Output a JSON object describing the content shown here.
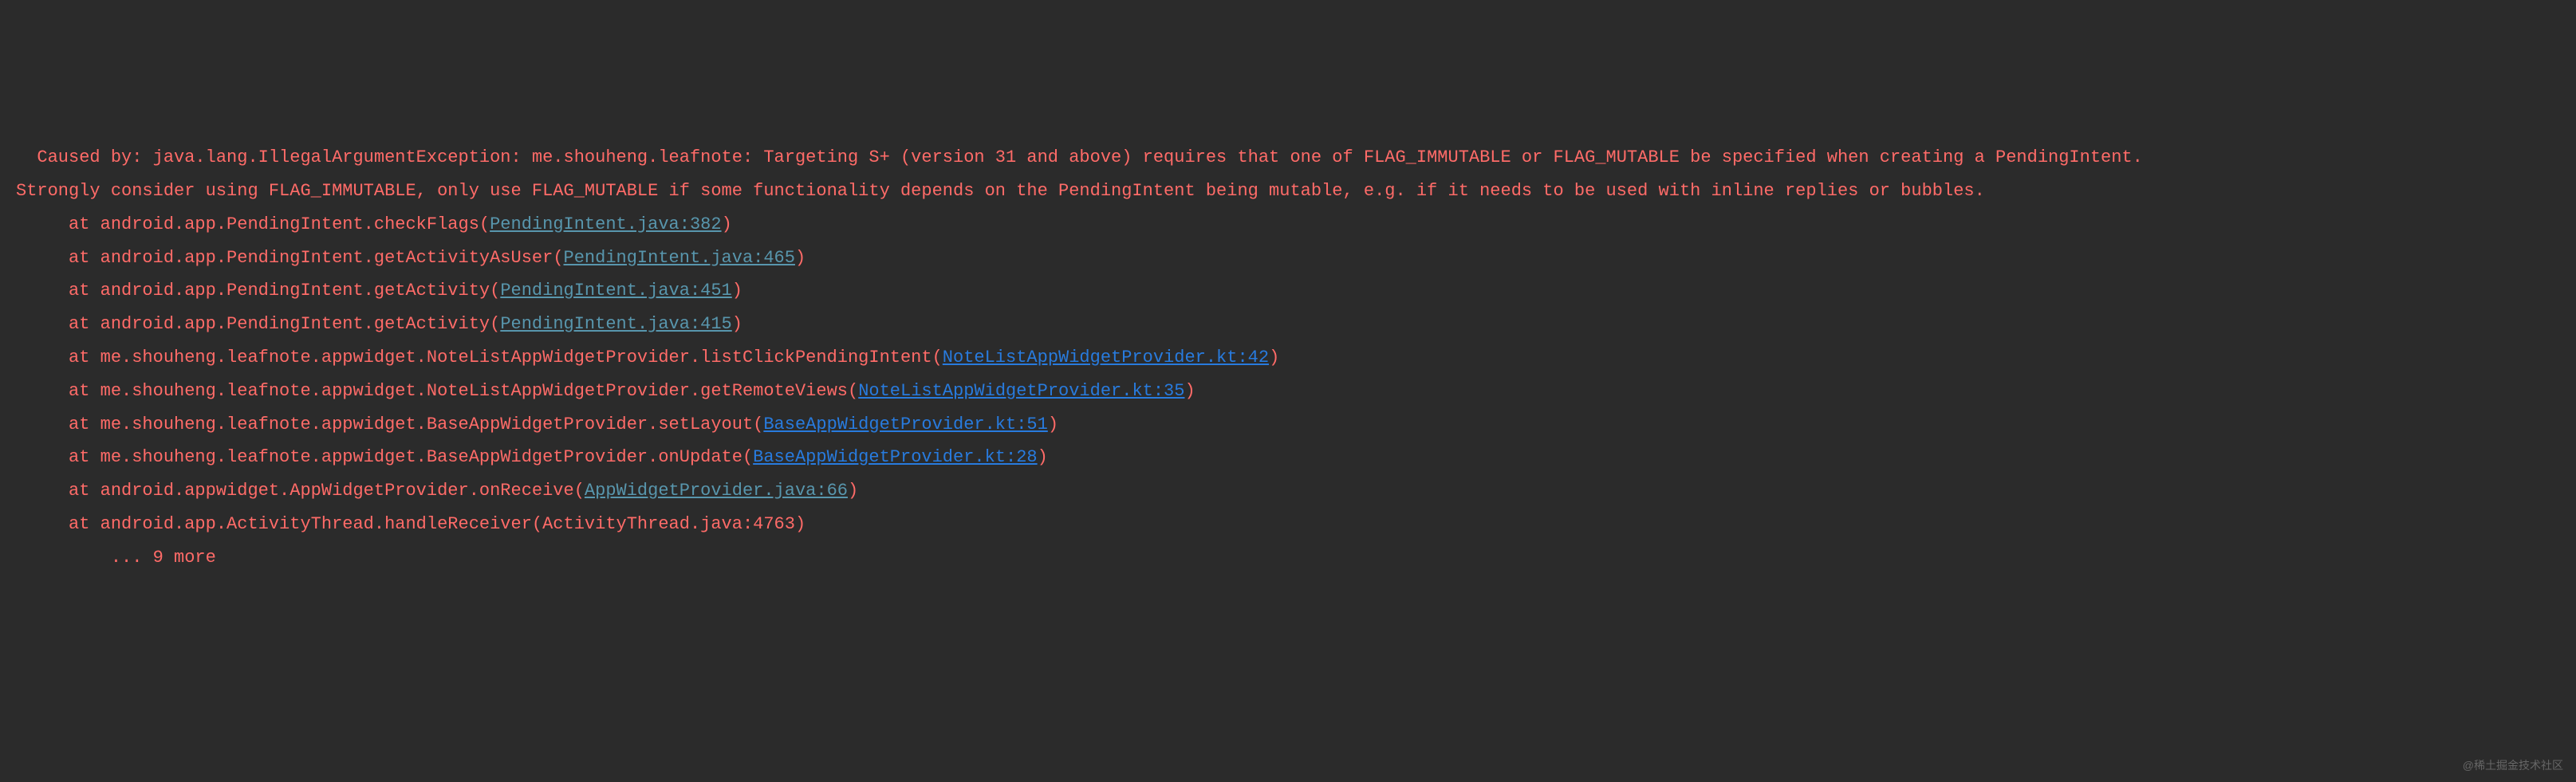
{
  "error_header_line1": "  Caused by: java.lang.IllegalArgumentException: me.shouheng.leafnote: Targeting S+ (version 31 and above) requires that one of FLAG_IMMUTABLE or FLAG_MUTABLE be specified when creating a PendingIntent.",
  "error_header_line2": "Strongly consider using FLAG_IMMUTABLE, only use FLAG_MUTABLE if some functionality depends on the PendingIntent being mutable, e.g. if it needs to be used with inline replies or bubbles.",
  "stack_frames": [
    {
      "indent": "     ",
      "at": "at ",
      "method": "android.app.PendingIntent.checkFlags",
      "open": "(",
      "file": "PendingIntent.java:382",
      "close": ")",
      "highlight": false
    },
    {
      "indent": "     ",
      "at": "at ",
      "method": "android.app.PendingIntent.getActivityAsUser",
      "open": "(",
      "file": "PendingIntent.java:465",
      "close": ")",
      "highlight": false
    },
    {
      "indent": "     ",
      "at": "at ",
      "method": "android.app.PendingIntent.getActivity",
      "open": "(",
      "file": "PendingIntent.java:451",
      "close": ")",
      "highlight": false
    },
    {
      "indent": "     ",
      "at": "at ",
      "method": "android.app.PendingIntent.getActivity",
      "open": "(",
      "file": "PendingIntent.java:415",
      "close": ")",
      "highlight": false
    },
    {
      "indent": "     ",
      "at": "at ",
      "method": "me.shouheng.leafnote.appwidget.NoteListAppWidgetProvider.listClickPendingIntent",
      "open": "(",
      "file": "NoteListAppWidgetProvider.kt:42",
      "close": ")",
      "highlight": true
    },
    {
      "indent": "     ",
      "at": "at ",
      "method": "me.shouheng.leafnote.appwidget.NoteListAppWidgetProvider.getRemoteViews",
      "open": "(",
      "file": "NoteListAppWidgetProvider.kt:35",
      "close": ")",
      "highlight": true
    },
    {
      "indent": "     ",
      "at": "at ",
      "method": "me.shouheng.leafnote.appwidget.BaseAppWidgetProvider.setLayout",
      "open": "(",
      "file": "BaseAppWidgetProvider.kt:51",
      "close": ")",
      "highlight": true
    },
    {
      "indent": "     ",
      "at": "at ",
      "method": "me.shouheng.leafnote.appwidget.BaseAppWidgetProvider.onUpdate",
      "open": "(",
      "file": "BaseAppWidgetProvider.kt:28",
      "close": ")",
      "highlight": true
    },
    {
      "indent": "     ",
      "at": "at ",
      "method": "android.appwidget.AppWidgetProvider.onReceive",
      "open": "(",
      "file": "AppWidgetProvider.java:66",
      "close": ")",
      "highlight": false
    },
    {
      "indent": "     ",
      "at": "at ",
      "method": "android.app.ActivityThread.handleReceiver(ActivityThread.java:4763)",
      "open": "",
      "file": "",
      "close": "",
      "highlight": false,
      "no_link": true
    }
  ],
  "more_line": "         ... 9 more",
  "watermark": "@稀土掘金技术社区"
}
